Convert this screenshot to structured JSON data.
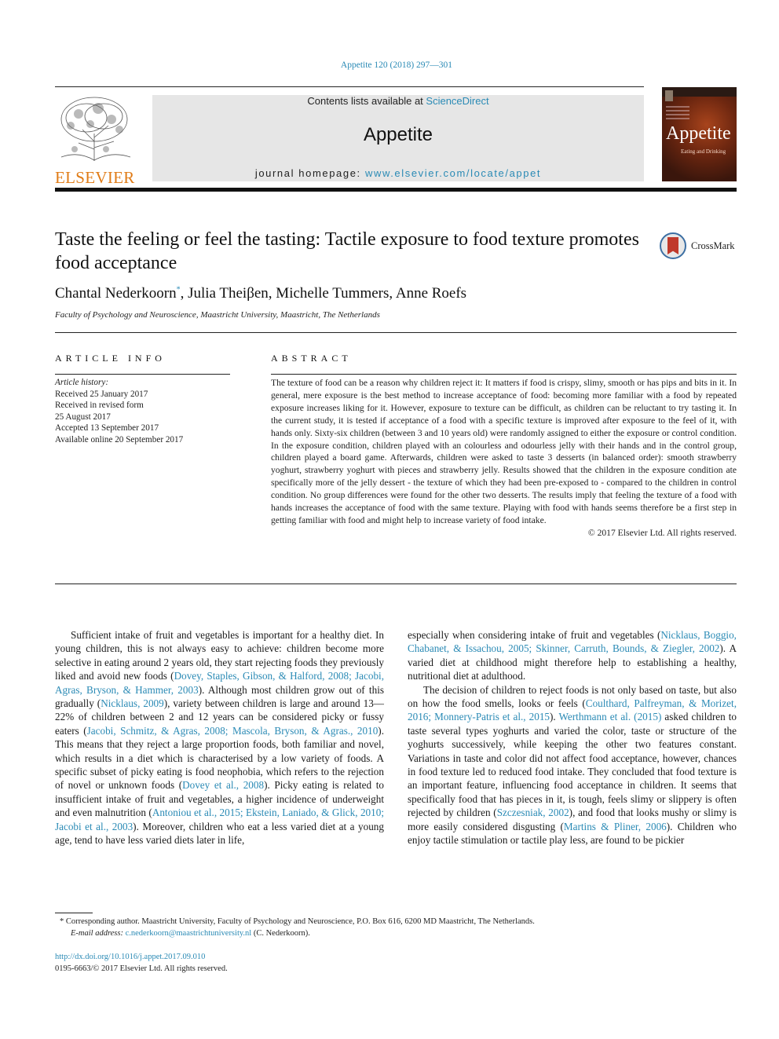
{
  "journal_citation": "Appetite 120 (2018) 297—301",
  "header": {
    "publisher_logo_text": "ELSEVIER",
    "contents_prefix": "Contents lists available at ",
    "contents_link": "ScienceDirect",
    "journal_name": "Appetite",
    "homepage_prefix": "journal homepage: ",
    "homepage_link": "www.elsevier.com/locate/appet",
    "cover_title": "Appetite",
    "cover_subtitle": "Eating and Drinking"
  },
  "article": {
    "title": "Taste the feeling or feel the tasting: Tactile exposure to food texture promotes food acceptance",
    "crossmark_label": "CrossMark",
    "authors_first": "Chantal Nederkoorn",
    "author_mark": "*",
    "authors_rest": ", Julia Theiβen, Michelle Tummers, Anne Roefs",
    "affiliation": "Faculty of Psychology and Neuroscience, Maastricht University, Maastricht, The Netherlands"
  },
  "article_info": {
    "heading": "ARTICLE INFO",
    "history_label": "Article history:",
    "history": [
      "Received 25 January 2017",
      "Received in revised form",
      "25 August 2017",
      "Accepted 13 September 2017",
      "Available online 20 September 2017"
    ]
  },
  "abstract": {
    "heading": "ABSTRACT",
    "text": "The texture of food can be a reason why children reject it: It matters if food is crispy, slimy, smooth or has pips and bits in it. In general, mere exposure is the best method to increase acceptance of food: becoming more familiar with a food by repeated exposure increases liking for it. However, exposure to texture can be difficult, as children can be reluctant to try tasting it. In the current study, it is tested if acceptance of a food with a specific texture is improved after exposure to the feel of it, with hands only. Sixty-six children (between 3 and 10 years old) were randomly assigned to either the exposure or control condition. In the exposure condition, children played with an colourless and odourless jelly with their hands and in the control group, children played a board game. Afterwards, children were asked to taste 3 desserts (in balanced order): smooth strawberry yoghurt, strawberry yoghurt with pieces and strawberry jelly. Results showed that the children in the exposure condition ate specifically more of the jelly dessert - the texture of which they had been pre-exposed to - compared to the children in control condition. No group differences were found for the other two desserts. The results imply that feeling the texture of a food with hands increases the acceptance of food with the same texture. Playing with food with hands seems therefore be a first step in getting familiar with food and might help to increase variety of food intake.",
    "copyright": "© 2017 Elsevier Ltd. All rights reserved."
  },
  "body": {
    "left": [
      {
        "t": "Sufficient intake of fruit and vegetables is important for a healthy diet. In young children, this is not always easy to achieve: children become more selective in eating around 2 years old, they start rejecting foods they previously liked and avoid new foods (",
        "l": false
      },
      {
        "t": "Dovey, Staples, Gibson, & Halford, 2008; Jacobi, Agras, Bryson, & Hammer, 2003",
        "l": true
      },
      {
        "t": "). Although most children grow out of this gradually (",
        "l": false
      },
      {
        "t": "Nicklaus, 2009",
        "l": true
      },
      {
        "t": "), variety between children is large and around 13—22% of children between 2 and 12 years can be considered picky or fussy eaters (",
        "l": false
      },
      {
        "t": "Jacobi, Schmitz, & Agras, 2008; Mascola, Bryson, & Agras., 2010",
        "l": true
      },
      {
        "t": "). This means that they reject a large proportion foods, both familiar and novel, which results in a diet which is characterised by a low variety of foods. A specific subset of picky eating is food neophobia, which refers to the rejection of novel or unknown foods (",
        "l": false
      },
      {
        "t": "Dovey et al., 2008",
        "l": true
      },
      {
        "t": "). Picky eating is related to insufficient intake of fruit and vegetables, a higher incidence of underweight and even malnutrition (",
        "l": false
      },
      {
        "t": "Antoniou et al., 2015; Ekstein, Laniado, & Glick, 2010; Jacobi et al., 2003",
        "l": true
      },
      {
        "t": "). Moreover, children who eat a less varied diet at a young age, tend to have less varied diets later in life,",
        "l": false
      }
    ],
    "right_p1": [
      {
        "t": "especially when considering intake of fruit and vegetables (",
        "l": false
      },
      {
        "t": "Nicklaus, Boggio, Chabanet, & Issachou, 2005; Skinner, Carruth, Bounds, & Ziegler, 2002",
        "l": true
      },
      {
        "t": "). A varied diet at childhood might therefore help to establishing a healthy, nutritional diet at adulthood.",
        "l": false
      }
    ],
    "right_p2": [
      {
        "t": "The decision of children to reject foods is not only based on taste, but also on how the food smells, looks or feels (",
        "l": false
      },
      {
        "t": "Coulthard, Palfreyman, & Morizet, 2016; Monnery-Patris et al., 2015",
        "l": true
      },
      {
        "t": "). ",
        "l": false
      },
      {
        "t": "Werthmann et al. (2015)",
        "l": true
      },
      {
        "t": " asked children to taste several types yoghurts and varied the color, taste or structure of the yoghurts successively, while keeping the other two features constant. Variations in taste and color did not affect food acceptance, however, chances in food texture led to reduced food intake. They concluded that food texture is an important feature, influencing food acceptance in children. It seems that specifically food that has pieces in it, is tough, feels slimy or slippery is often rejected by children (",
        "l": false
      },
      {
        "t": "Szczesniak, 2002",
        "l": true
      },
      {
        "t": "), and food that looks mushy or slimy is more easily considered disgusting (",
        "l": false
      },
      {
        "t": "Martins & Pliner, 2006",
        "l": true
      },
      {
        "t": "). Children who enjoy tactile stimulation or tactile play less, are found to be pickier",
        "l": false
      }
    ]
  },
  "footnote": {
    "marker": "*",
    "corresponding": " Corresponding author. Maastricht University, Faculty of Psychology and Neuroscience, P.O. Box 616, 6200 MD Maastricht, The Netherlands.",
    "email_label": "E-mail address:",
    "email": "c.nederkoorn@maastrichtuniversity.nl",
    "email_suffix": " (C. Nederkoorn)."
  },
  "doi": "http://dx.doi.org/10.1016/j.appet.2017.09.010",
  "issn_line": "0195-6663/© 2017 Elsevier Ltd. All rights reserved.",
  "colors": {
    "link": "#2a8ab5",
    "elsevier_orange": "#e07b16",
    "header_bg": "#e6e6e6"
  }
}
